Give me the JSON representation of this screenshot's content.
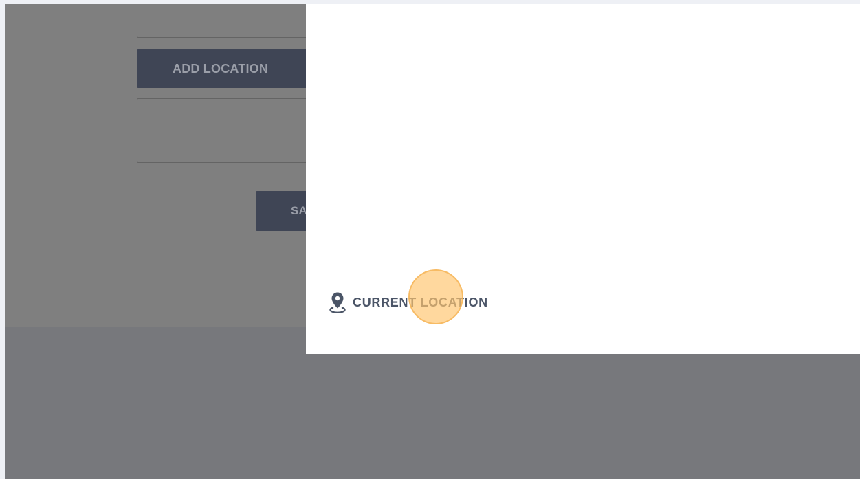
{
  "background_form": {
    "add_location_label": "ADD LOCATION",
    "save_label_visible": "SA"
  },
  "location_panel": {
    "current_location_label": "CURRENT LOCATION",
    "icon": "map-pin-icon"
  },
  "colors": {
    "page_background": "#eef0f5",
    "overlay_dark": "#77787c",
    "button_dark": "#3f4555",
    "text_dark_blue": "#4b5567",
    "click_highlight": "#ffc670"
  }
}
